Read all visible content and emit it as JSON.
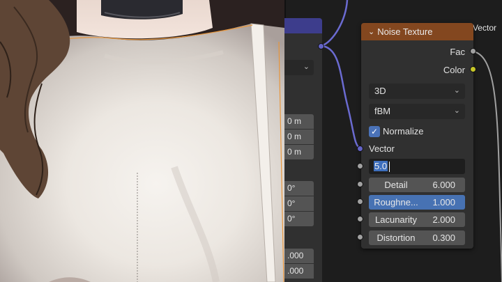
{
  "viewport": {
    "description_icon": "3d-viewport"
  },
  "mapping_node": {
    "output_vector_label": "Vector",
    "location_values": [
      "0 m",
      "0 m",
      "0 m"
    ],
    "rotation_values": [
      "0°",
      "0°",
      "0°"
    ],
    "scale_values": [
      ".000",
      ".000"
    ]
  },
  "noise_node": {
    "title": "Noise Texture",
    "header_color": "#83471f",
    "outputs": {
      "fac": "Fac",
      "color": "Color"
    },
    "dimensions": "3D",
    "type": "fBM",
    "normalize_label": "Normalize",
    "normalize_checked": true,
    "vector_input_label": "Vector",
    "scale_value": "5.0",
    "params": [
      {
        "label": "Detail",
        "value": "6.000",
        "active": false
      },
      {
        "label": "Roughne...",
        "value": "1.000",
        "active": true
      },
      {
        "label": "Lacunarity",
        "value": "2.000",
        "active": false
      },
      {
        "label": "Distortion",
        "value": "0.300",
        "active": false
      }
    ]
  },
  "colors": {
    "vector_socket": "#6363c7",
    "float_socket": "#a1a1a1",
    "color_socket": "#c7c729",
    "accent": "#4772b3"
  },
  "icons": {
    "collapse": "chevron-down-icon",
    "dropdown": "chevron-down-icon",
    "check": "checkmark-icon"
  }
}
